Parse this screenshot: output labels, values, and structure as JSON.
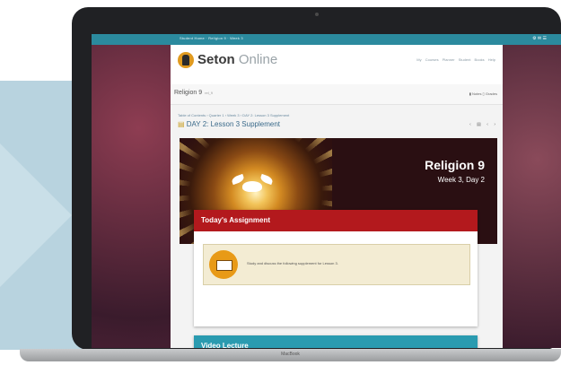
{
  "topbar": {
    "links": "Student Home  ·  Religion 9  ·  Week 3",
    "tools": "⚙  ✉  ☰"
  },
  "header": {
    "logo_bold": "Seton",
    "logo_light": " Online",
    "nav": "My Courses   Planner   Student Books   Help"
  },
  "subheader": {
    "course": "Religion 9",
    "course_small": "rel_9",
    "tools": "▮ Notes   ▯ Grades"
  },
  "lesson": {
    "breadcrumb": "Table of Contents  ›  Quarter 1  ›  Week 3  ›  DAY 2: Lesson 3 Supplement",
    "title": "DAY 2: Lesson 3 Supplement",
    "tools": "‹   ▤   ‹   ›"
  },
  "banner": {
    "title": "Religion 9",
    "subtitle": "Week 3, Day 2"
  },
  "assignment": {
    "heading": "Today's Assignment",
    "text": "Study and discuss the following supplement for Lesson 3."
  },
  "video": {
    "heading": "Video Lecture"
  },
  "laptop": {
    "label": "MacBook"
  }
}
